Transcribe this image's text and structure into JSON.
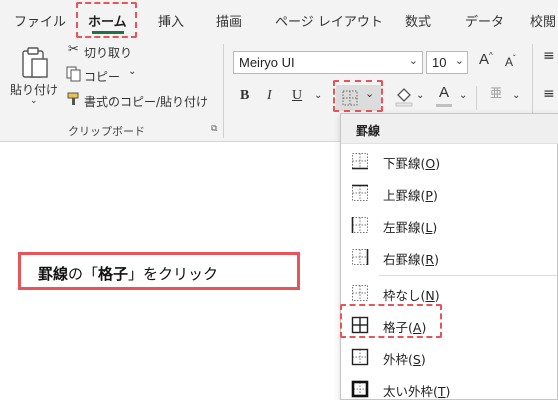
{
  "tabs": [
    {
      "label": "ファイル"
    },
    {
      "label": "ホーム"
    },
    {
      "label": "挿入"
    },
    {
      "label": "描画"
    },
    {
      "label": "ページ レイアウト"
    },
    {
      "label": "数式"
    },
    {
      "label": "データ"
    },
    {
      "label": "校閲"
    }
  ],
  "clipboard": {
    "paste_label": "貼り付け",
    "cut_label": "切り取り",
    "copy_label": "コピー",
    "format_painter_label": "書式のコピー/貼り付け",
    "group_label": "クリップボード"
  },
  "font": {
    "name": "Meiryo UI",
    "size": "10",
    "increase_label": "A",
    "decrease_label": "A",
    "bold_label": "B",
    "italic_label": "I",
    "underline_label": "U",
    "font_color_label": "A"
  },
  "menu": {
    "header": "罫線",
    "items": [
      {
        "label": "下罫線(O)",
        "mnemonic": "O",
        "icon": "border-bottom-icon"
      },
      {
        "label": "上罫線(P)",
        "mnemonic": "P",
        "icon": "border-top-icon"
      },
      {
        "label": "左罫線(L)",
        "mnemonic": "L",
        "icon": "border-left-icon"
      },
      {
        "label": "右罫線(R)",
        "mnemonic": "R",
        "icon": "border-right-icon"
      },
      {
        "label": "枠なし(N)",
        "mnemonic": "N",
        "icon": "no-border-icon"
      },
      {
        "label": "格子(A)",
        "mnemonic": "A",
        "icon": "all-borders-icon"
      },
      {
        "label": "外枠(S)",
        "mnemonic": "S",
        "icon": "outside-borders-icon"
      },
      {
        "label": "太い外枠(T)",
        "mnemonic": "T",
        "icon": "thick-box-border-icon"
      }
    ]
  },
  "callout": {
    "part1": "罫線",
    "part2": "の「",
    "part3": "格子",
    "part4": "」をクリック"
  },
  "colors": {
    "highlight": "#e8545a",
    "accent_green": "#207245",
    "ribbon_bg": "#f3f3f3"
  }
}
